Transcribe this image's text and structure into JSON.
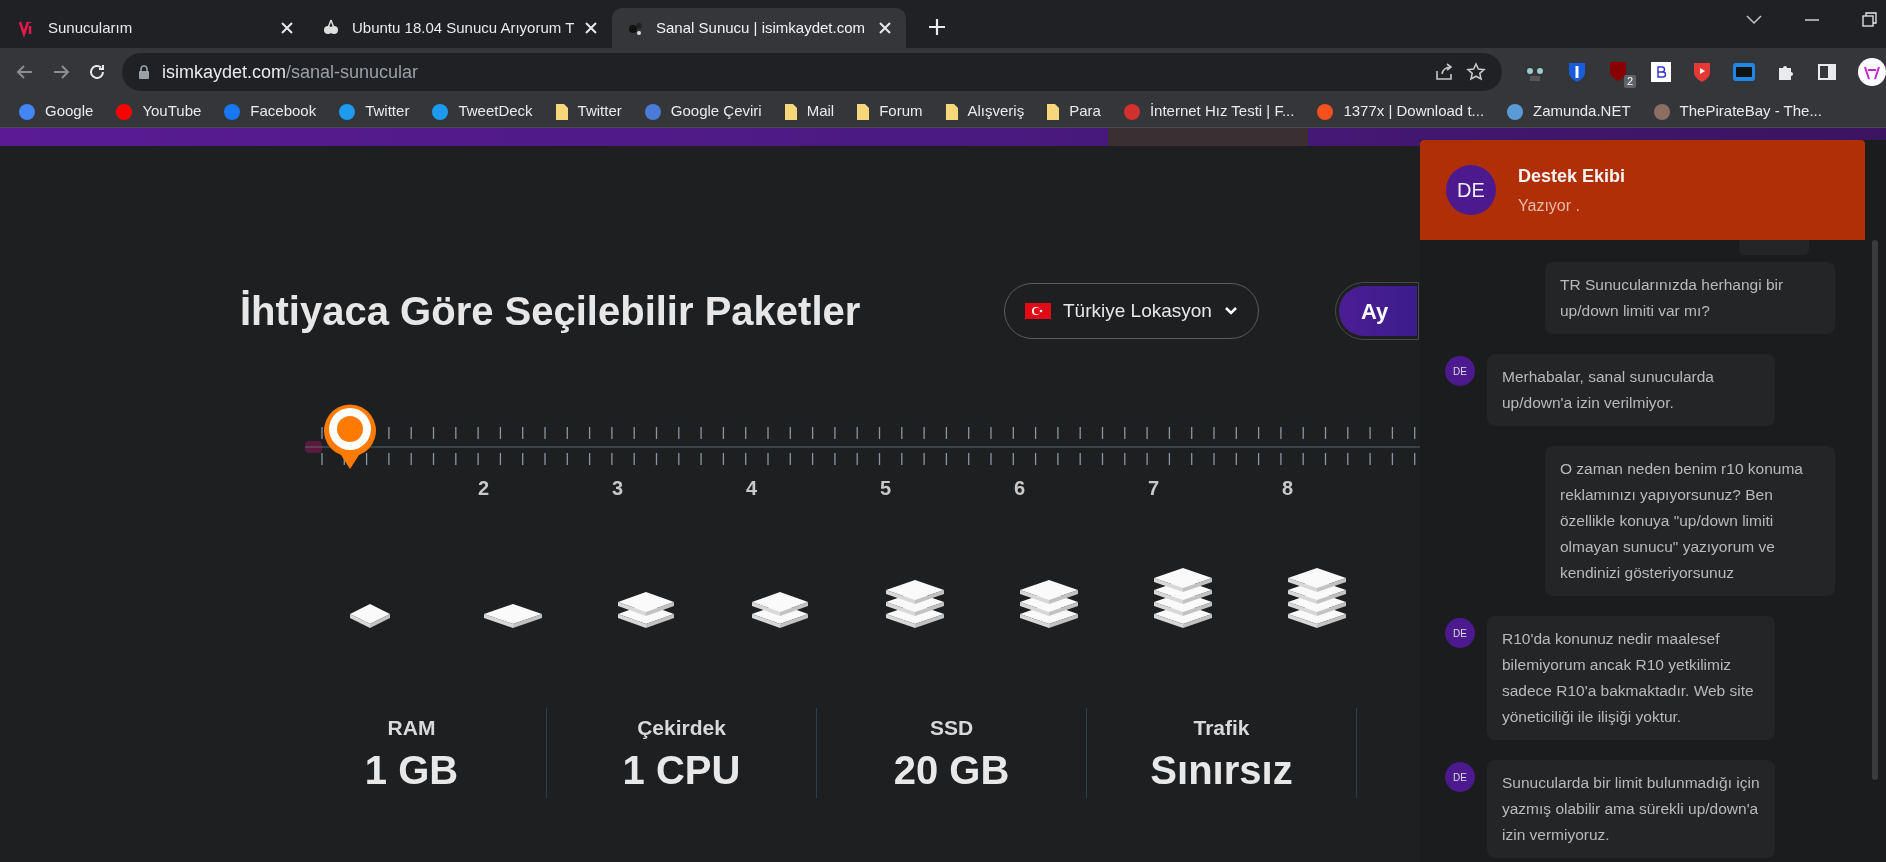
{
  "tabs": [
    {
      "title": "Sunucularım",
      "selected": false
    },
    {
      "title": "Ubuntu 18.04 Sunucu Arıyorum T",
      "selected": false
    },
    {
      "title": "Sanal Sunucu | isimkaydet.com",
      "selected": true
    }
  ],
  "address_bar": {
    "domain": "isimkaydet.com",
    "path": "/sanal-sunucular"
  },
  "extension_badge": "2",
  "bookmarks": [
    {
      "label": "Google",
      "kind": "site"
    },
    {
      "label": "YouTube",
      "kind": "site"
    },
    {
      "label": "Facebook",
      "kind": "site"
    },
    {
      "label": "Twitter",
      "kind": "site"
    },
    {
      "label": "TweetDeck",
      "kind": "site"
    },
    {
      "label": "Twitter",
      "kind": "folder"
    },
    {
      "label": "Google Çeviri",
      "kind": "site"
    },
    {
      "label": "Mail",
      "kind": "folder"
    },
    {
      "label": "Forum",
      "kind": "folder"
    },
    {
      "label": "Alışveriş",
      "kind": "folder"
    },
    {
      "label": "Para",
      "kind": "folder"
    },
    {
      "label": "İnternet Hız Testi | F...",
      "kind": "site"
    },
    {
      "label": "1377x | Download t...",
      "kind": "site"
    },
    {
      "label": "Zamunda.NET",
      "kind": "site"
    },
    {
      "label": "ThePirateBay - The...",
      "kind": "site"
    }
  ],
  "heading": "İhtiyaca Göre Seçilebilir Paketler",
  "location_dropdown": "Türkiye Lokasyon",
  "period_button": "Ay",
  "slider": {
    "level": 0,
    "labels": [
      "2",
      "3",
      "4",
      "5",
      "6",
      "7",
      "8"
    ]
  },
  "specs": [
    {
      "label": "RAM",
      "value": "1 GB"
    },
    {
      "label": "Çekirdek",
      "value": "1 CPU"
    },
    {
      "label": "SSD",
      "value": "20 GB"
    },
    {
      "label": "Trafik",
      "value": "Sınırsız"
    }
  ],
  "chat": {
    "agent_initials": "DE",
    "agent_name": "Destek Ekibi",
    "status": "Yazıyor .",
    "messages": [
      {
        "kind": "user",
        "text": "TR Sunucularınızda herhangi bir up/down limiti var mı?"
      },
      {
        "kind": "agent",
        "initials": "DE",
        "text": "Merhabalar, sanal sunucularda up/down'a izin verilmiyor."
      },
      {
        "kind": "user",
        "text": "O zaman neden benim r10 konuma reklamınızı yapıyorsunuz? Ben özellikle konuya \"up/down limiti olmayan sunucu\" yazıyorum ve kendinizi gösteriyorsunuz"
      },
      {
        "kind": "agent",
        "initials": "DE",
        "text": "R10'da konunuz nedir maalesef bilemiyorum ancak R10 yetkilimiz sadece R10'a bakmaktadır. Web site yöneticiliği ile ilişiği yoktur."
      },
      {
        "kind": "agent",
        "initials": "DE",
        "text": "Sunucularda bir limit bulunmadığı için yazmış olabilir ama sürekli up/down'a izin vermiyoruz."
      }
    ]
  }
}
